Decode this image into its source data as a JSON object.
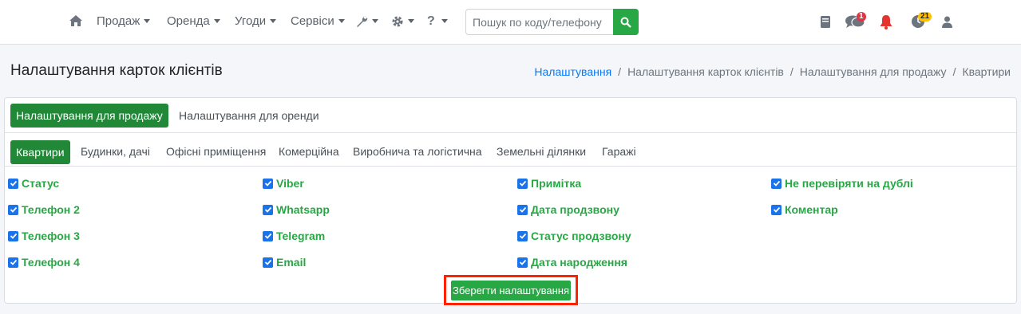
{
  "navbar": {
    "items": [
      {
        "label": "Продаж"
      },
      {
        "label": "Оренда"
      },
      {
        "label": "Угоди"
      },
      {
        "label": "Сервіси"
      }
    ],
    "search": {
      "placeholder": "Пошук по коду/телефону"
    },
    "badges": {
      "messages": "1",
      "history": "21"
    }
  },
  "header": {
    "title": "Налаштування карток клієнтів",
    "breadcrumb": [
      "Налаштування",
      "Налаштування карток клієнтів",
      "Налаштування для продажу",
      "Квартири"
    ]
  },
  "mode_tabs": [
    "Налаштування для продажу",
    "Налаштування для оренди"
  ],
  "category_tabs": [
    "Квартири",
    "Будинки, дачі",
    "Офісні приміщення",
    "Комерційна",
    "Виробнича та логістична",
    "Земельні ділянки",
    "Гаражі"
  ],
  "fields": {
    "col1": [
      "Статус",
      "Телефон 2",
      "Телефон 3",
      "Телефон 4"
    ],
    "col2": [
      "Viber",
      "Whatsapp",
      "Telegram",
      "Email"
    ],
    "col3": [
      "Примітка",
      "Дата продзвону",
      "Статус продзвону",
      "Дата народження"
    ],
    "col4": [
      "Не перевіряти на дублі",
      "Коментар"
    ]
  },
  "save_label": "Зберегти налаштування",
  "colors": {
    "accent": "#28a745",
    "active_tab": "#218838",
    "link": "#007bff",
    "highlight": "#ff2200"
  }
}
